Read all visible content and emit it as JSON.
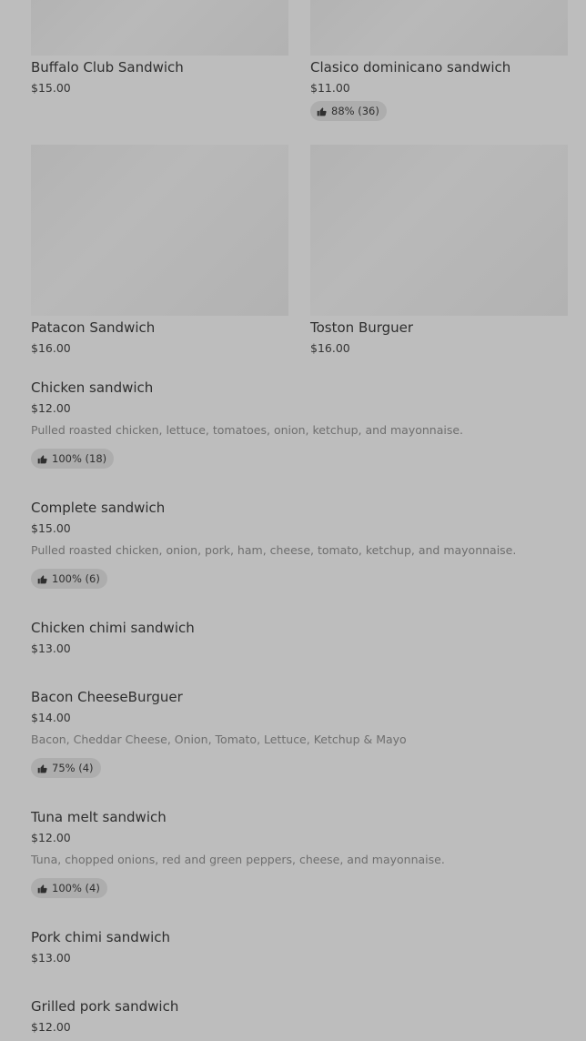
{
  "grid_items": [
    {
      "name": "Buffalo Club Sandwich",
      "price": "$15.00"
    },
    {
      "name": "Clasico dominicano sandwich",
      "price": "$11.00",
      "rating": "88% (36)"
    },
    {
      "name": "Patacon Sandwich",
      "price": "$16.00"
    },
    {
      "name": "Toston Burguer",
      "price": "$16.00"
    }
  ],
  "list_items": [
    {
      "name": "Chicken sandwich",
      "price": "$12.00",
      "description": "Pulled roasted chicken, lettuce, tomatoes, onion, ketchup, and mayonnaise.",
      "rating": "100% (18)"
    },
    {
      "name": "Complete sandwich",
      "price": "$15.00",
      "description": "Pulled roasted chicken, onion, pork, ham, cheese, tomato, ketchup, and mayonnaise.",
      "rating": "100% (6)"
    },
    {
      "name": "Chicken chimi sandwich",
      "price": "$13.00"
    },
    {
      "name": "Bacon CheeseBurguer",
      "price": "$14.00",
      "description": "Bacon, Cheddar Cheese, Onion, Tomato, Lettuce, Ketchup & Mayo",
      "rating": "75% (4)"
    },
    {
      "name": "Tuna melt sandwich",
      "price": "$12.00",
      "description": "Tuna, chopped onions, red and green peppers, cheese, and mayonnaise.",
      "rating": "100% (4)"
    },
    {
      "name": "Pork chimi sandwich",
      "price": "$13.00"
    },
    {
      "name": "Grilled pork sandwich",
      "price": "$12.00"
    }
  ]
}
